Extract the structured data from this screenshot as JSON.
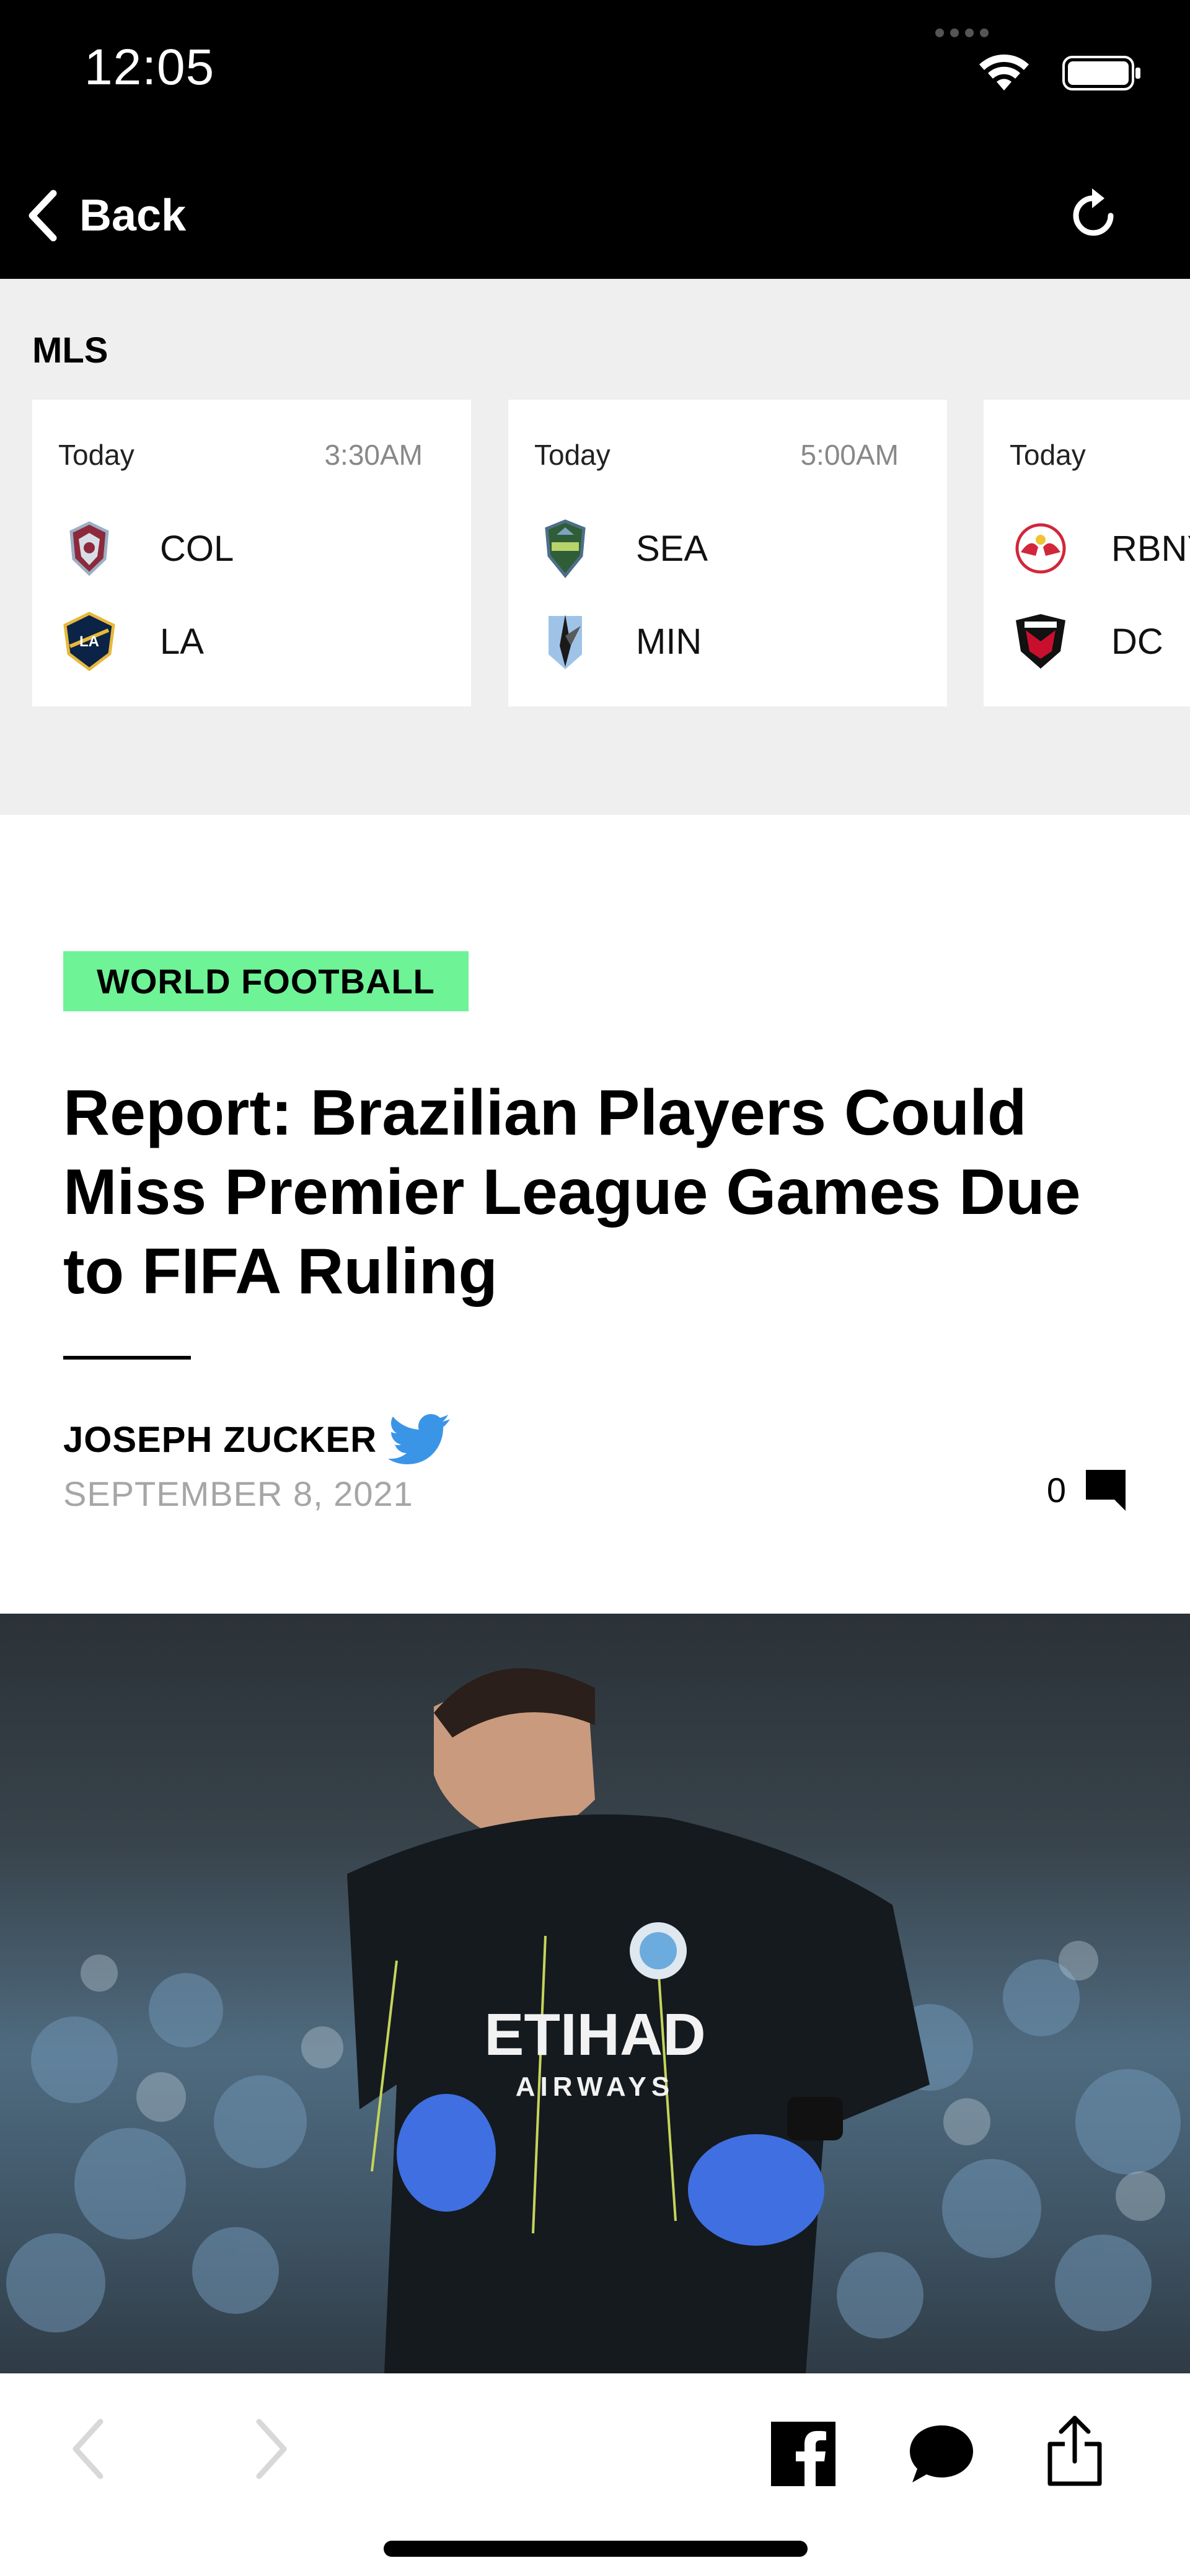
{
  "status_bar": {
    "time": "12:05"
  },
  "nav": {
    "back_label": "Back"
  },
  "scores": {
    "league": "MLS",
    "games": [
      {
        "day": "Today",
        "time": "3:30AM",
        "home": "COL",
        "away": "LA"
      },
      {
        "day": "Today",
        "time": "5:00AM",
        "home": "SEA",
        "away": "MIN"
      },
      {
        "day": "Today",
        "time": "",
        "home": "RBNY",
        "away": "DC"
      }
    ]
  },
  "article": {
    "category": "WORLD FOOTBALL",
    "headline": "Report: Brazilian Players Could Miss Premier League Games Due to FIFA Ruling",
    "author": "JOSEPH ZUCKER",
    "date": "SEPTEMBER 8, 2021",
    "comment_count": "0"
  },
  "hero": {
    "jersey_text": "ETIHAD",
    "jersey_sub": "AIRWAYS"
  },
  "icons": [
    "chevron-left-icon",
    "refresh-icon",
    "wifi-icon",
    "battery-icon",
    "twitter-icon",
    "comment-icon",
    "facebook-icon",
    "chat-bubble-icon",
    "share-icon"
  ],
  "colors": {
    "tag": "#6ef396",
    "twitter": "#3b95e6",
    "date": "#a6a6a6"
  }
}
